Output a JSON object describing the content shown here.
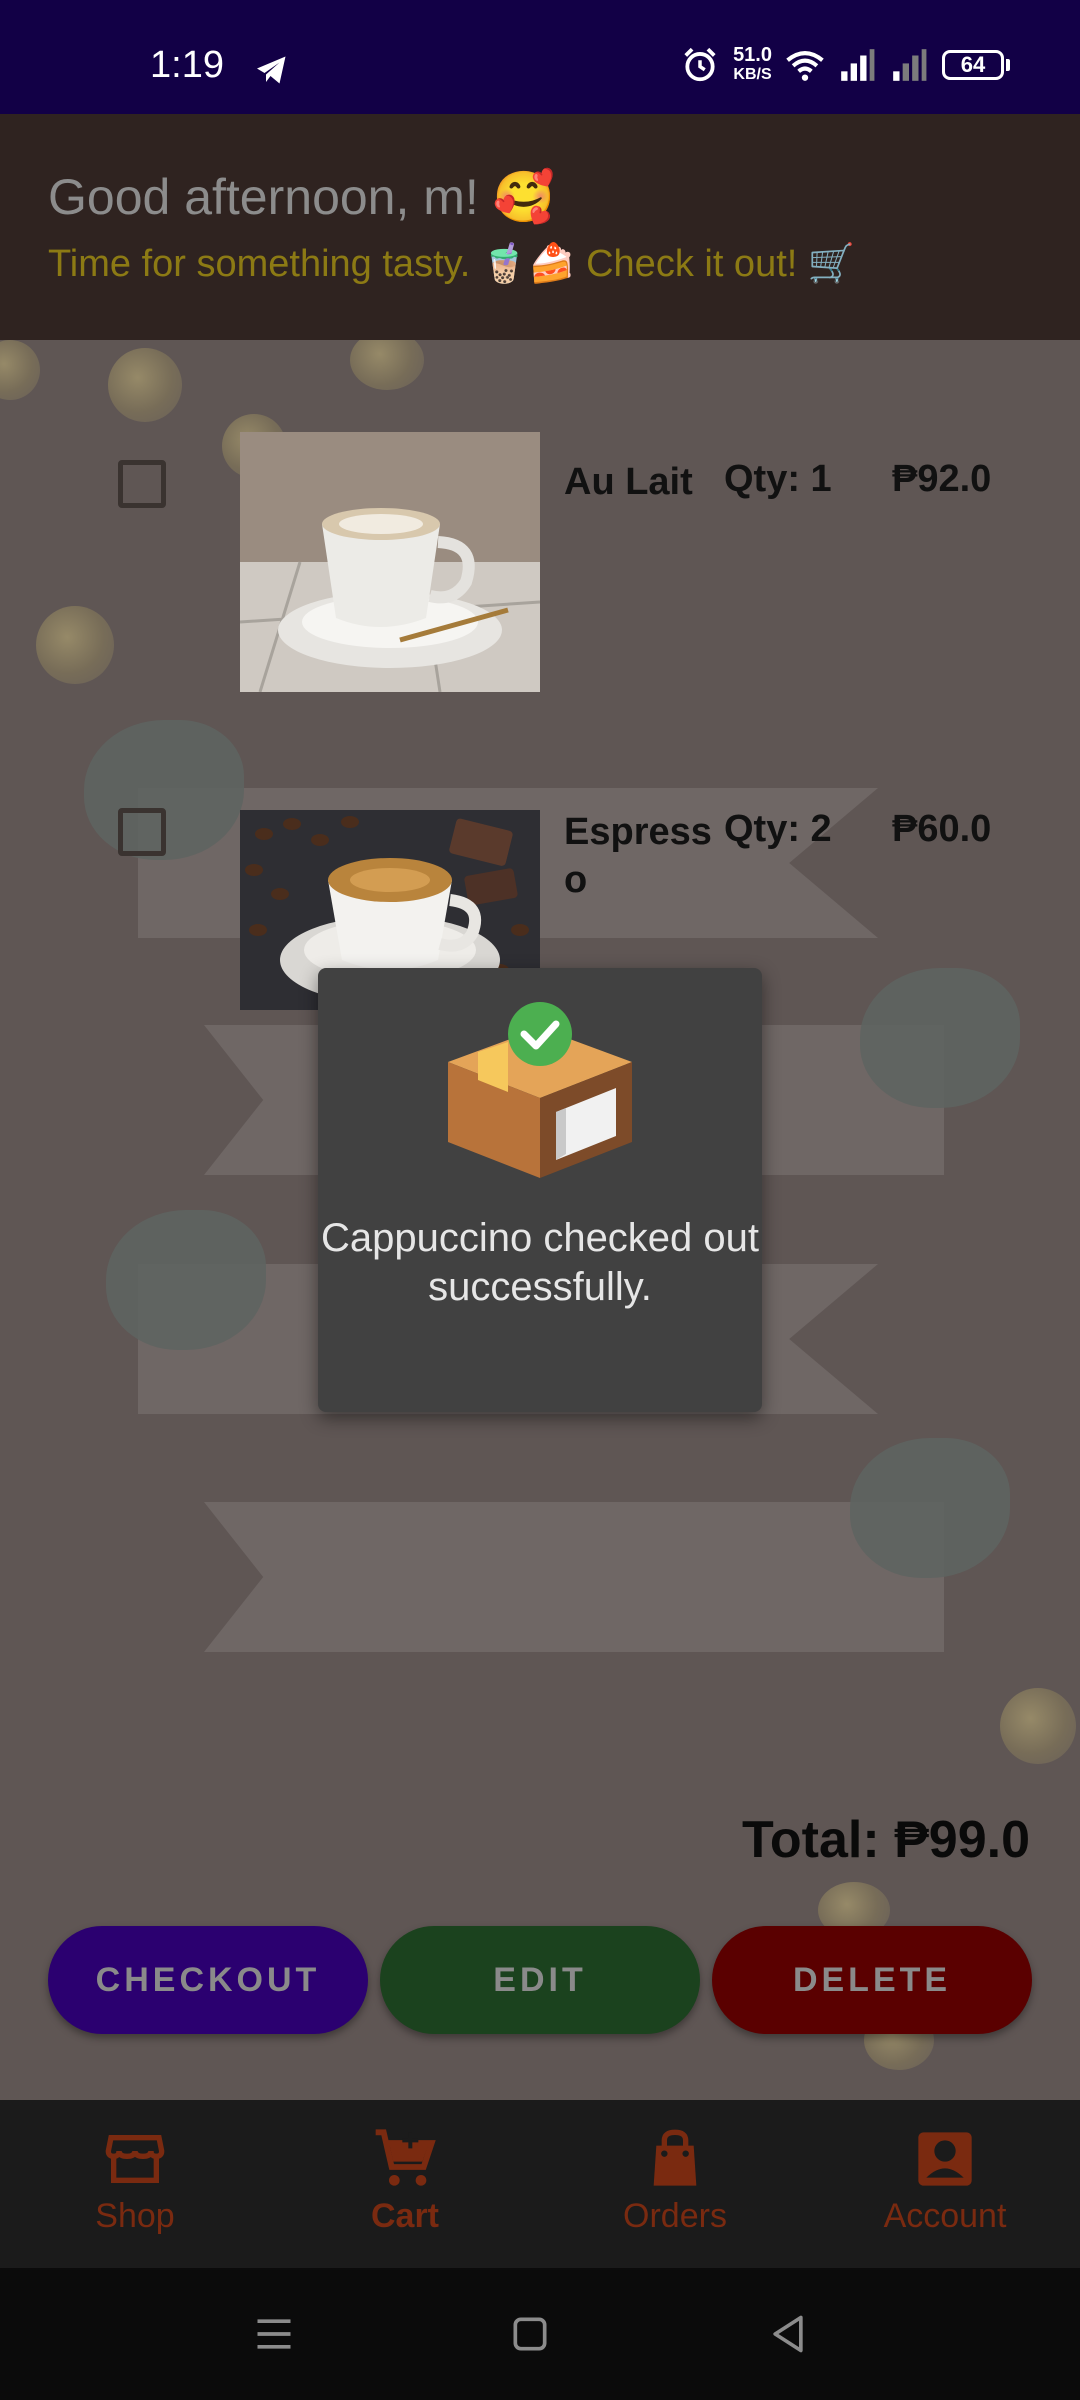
{
  "status_bar": {
    "time": "1:19",
    "net_speed_value": "51.0",
    "net_speed_unit": "KB/S",
    "battery": "64",
    "icons": [
      "telegram-icon",
      "alarm-icon",
      "wifi-icon",
      "signal-icon",
      "signal-icon"
    ]
  },
  "header": {
    "greeting": "Good afternoon, m! 🥰",
    "subtitle": "Time for something tasty. 🧋🍰 Check it out! 🛒"
  },
  "cart": {
    "items": [
      {
        "name": "Au Lait",
        "qty": "Qty: 1",
        "price": "₱92.0",
        "image": "coffee-cup-latte"
      },
      {
        "name": "Espresso",
        "qty": "Qty: 2",
        "price": "₱60.0",
        "image": "coffee-cup-beans"
      }
    ],
    "total": "Total: ₱99.0"
  },
  "actions": {
    "checkout": "CHECKOUT",
    "edit": "EDIT",
    "delete": "DELETE"
  },
  "toast": {
    "message": "Cappuccino checked out successfully.",
    "icon": "package-check-icon"
  },
  "bottom_nav": {
    "items": [
      {
        "label": "Shop",
        "icon": "store-icon"
      },
      {
        "label": "Cart",
        "icon": "cart-icon",
        "active": true
      },
      {
        "label": "Orders",
        "icon": "bag-icon"
      },
      {
        "label": "Account",
        "icon": "account-icon"
      }
    ]
  },
  "colors": {
    "status_bar": "#120046",
    "header": "#2f2320",
    "checkout": "#2b0070",
    "edit": "#1b421e",
    "delete": "#5a0000",
    "nav_accent": "#7a2a10"
  }
}
